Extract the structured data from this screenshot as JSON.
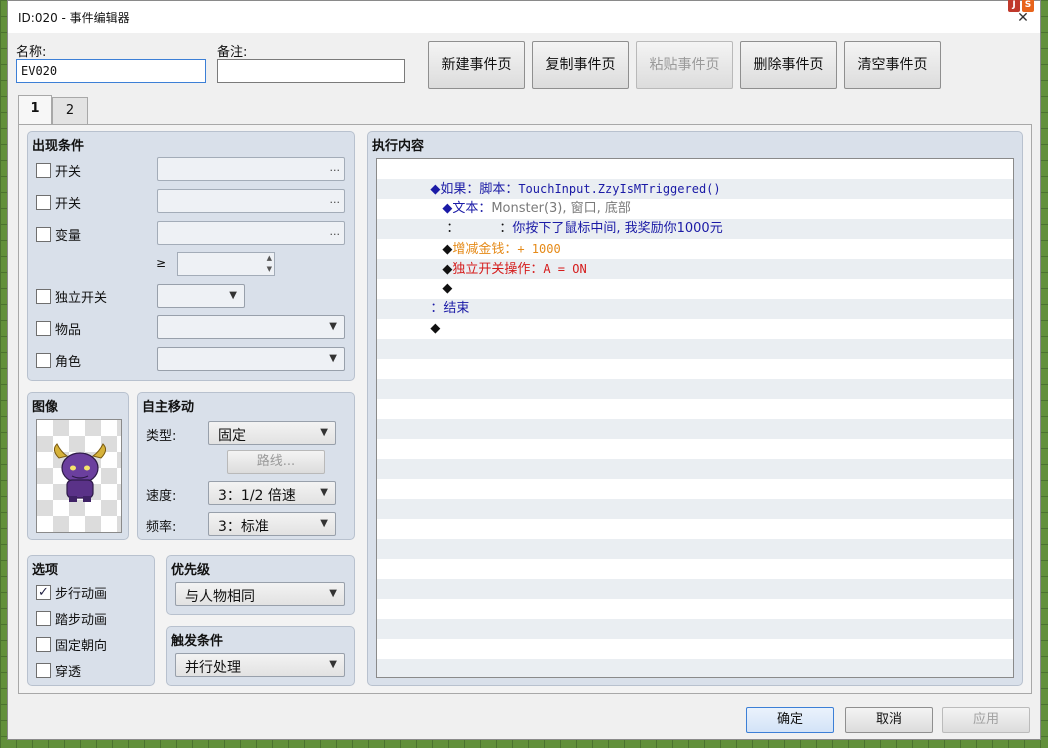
{
  "window": {
    "title": "ID:020 - 事件编辑器"
  },
  "header": {
    "name_label": "名称:",
    "name_value": "EV020",
    "note_label": "备注:",
    "note_value": "",
    "buttons": {
      "new_page": "新建事件页",
      "copy_page": "复制事件页",
      "paste_page": "粘贴事件页",
      "delete_page": "删除事件页",
      "clear_page": "清空事件页"
    }
  },
  "tabs": [
    "1",
    "2"
  ],
  "conditions": {
    "title": "出现条件",
    "switch1": "开关",
    "switch2": "开关",
    "variable": "变量",
    "gte": "≥",
    "self_switch": "独立开关",
    "item": "物品",
    "actor": "角色",
    "ellipsis": "..."
  },
  "image": {
    "title": "图像"
  },
  "autonomous": {
    "title": "自主移动",
    "type_label": "类型:",
    "type_value": "固定",
    "route_button": "路线...",
    "speed_label": "速度:",
    "speed_value": "3：1/2 倍速",
    "freq_label": "频率:",
    "freq_value": "3：标准"
  },
  "options": {
    "title": "选项",
    "walking": "步行动画",
    "walking_checked": "✓",
    "stepping": "踏步动画",
    "direction_fix": "固定朝向",
    "through": "穿透"
  },
  "priority": {
    "title": "优先级",
    "value": "与人物相同"
  },
  "trigger": {
    "title": "触发条件",
    "value": "并行处理"
  },
  "contents": {
    "title": "执行内容",
    "lines": {
      "l1_prefix": "◆如果：脚本：",
      "l1_script": "TouchInput.ZzyIsMTriggered()",
      "l2_prefix": "◆文本：",
      "l2_detail": "Monster(3), 窗口, 底部",
      "l3_colon": "：",
      "l3_colon2": "：",
      "l3_text": "你按下了鼠标中间, 我奖励你1000元",
      "l4_label": "增减金钱：",
      "l4_value": "+ 1000",
      "l5_label": "独立开关操作：",
      "l5_value": "A = ON",
      "l6": "◆",
      "l7_colon": "：",
      "l7_end": "结束",
      "l8": "◆",
      "diamond": "◆"
    }
  },
  "footer": {
    "ok": "确定",
    "cancel": "取消",
    "apply": "应用"
  },
  "colors": {
    "command_blue": "#1a1aa6",
    "command_gray": "#7a7a7a",
    "gold_red": "#e58a18",
    "self_switch_red": "#d51c1c"
  }
}
